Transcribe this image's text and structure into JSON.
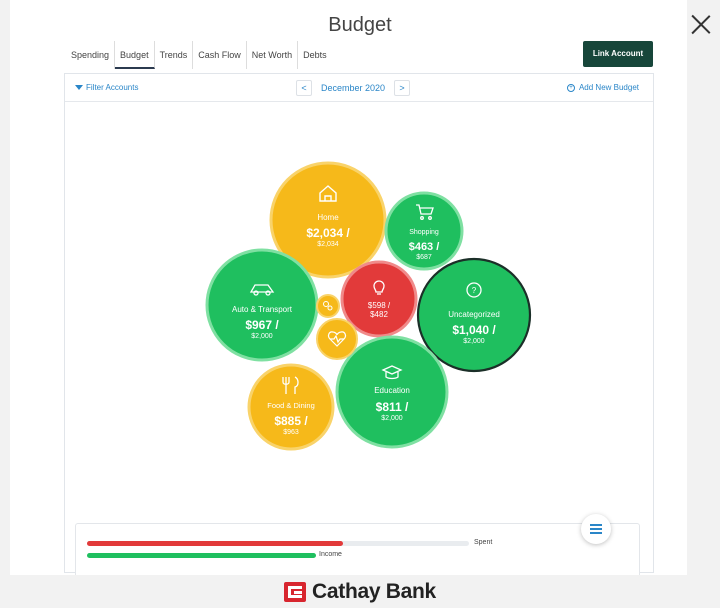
{
  "window": {
    "title": "Budget"
  },
  "tabs": [
    {
      "label": "Spending"
    },
    {
      "label": "Budget"
    },
    {
      "label": "Trends"
    },
    {
      "label": "Cash Flow"
    },
    {
      "label": "Net Worth"
    },
    {
      "label": "Debts"
    }
  ],
  "header": {
    "link_account": "Link Account"
  },
  "toolbar": {
    "filter": "Filter Accounts",
    "month": "December 2020",
    "prev": "<",
    "next": ">",
    "add_budget": "Add New Budget"
  },
  "colors": {
    "green": "#1fbf5f",
    "yellow": "#f6b91a",
    "red": "#e23a3a",
    "brand": "#d8262f",
    "link": "#2a86c8"
  },
  "budgets": [
    {
      "name": "Home",
      "spent": "$2,034 /",
      "budget": "$2,034",
      "icon": "home-icon",
      "status": "warning"
    },
    {
      "name": "Shopping",
      "spent": "$463 /",
      "budget": "$687",
      "icon": "shopping-cart-icon",
      "status": "ok"
    },
    {
      "name": "Auto & Transport",
      "spent": "$967 /",
      "budget": "$2,000",
      "icon": "car-icon",
      "status": "ok"
    },
    {
      "name": "",
      "spent": "$598 /",
      "budget": "$482",
      "icon": "lightbulb-icon",
      "status": "over"
    },
    {
      "name": "Uncategorized",
      "spent": "$1,040 /",
      "budget": "$2,000",
      "icon": "question-icon",
      "status": "ok"
    },
    {
      "name": "Education",
      "spent": "$811 /",
      "budget": "$2,000",
      "icon": "graduation-cap-icon",
      "status": "ok"
    },
    {
      "name": "Food & Dining",
      "spent": "$885 /",
      "budget": "$963",
      "icon": "fork-knife-icon",
      "status": "warning"
    },
    {
      "name": "",
      "spent": "",
      "budget": "",
      "icon": "baby-icon",
      "status": "warning"
    },
    {
      "name": "",
      "spent": "",
      "budget": "",
      "icon": "heart-pulse-icon",
      "status": "warning"
    }
  ],
  "summary": {
    "spent_label": "Spent",
    "income_label": "Income",
    "spent_fraction": 0.67,
    "income_fraction": 0.6
  },
  "footer": {
    "brand": "Cathay Bank"
  }
}
